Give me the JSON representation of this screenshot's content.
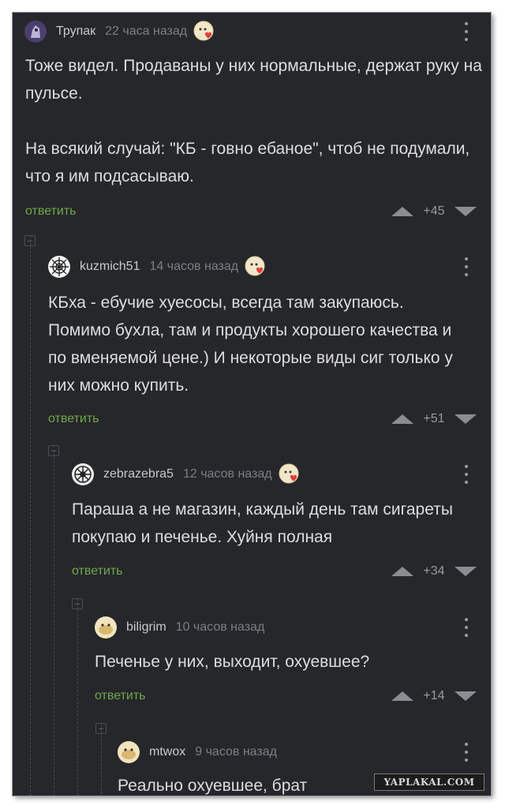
{
  "comments": [
    {
      "username": "Трупак",
      "time": "22 часа назад",
      "text": "Тоже видел. Продаваны у них нормальные, держат руку на пульсе.\n\nНа всякий случай: \"КБ - говно ебаное\", чтоб не подумали, что я им подсасываю.",
      "reply_label": "ответить",
      "score": "+45",
      "avatar_icon": "knight-avatar-icon",
      "has_badge": true
    },
    {
      "username": "kuzmich51",
      "time": "14 часов назад",
      "text": "КБха - ебучие хуесосы, всегда там закупаюсь. Помимо бухла, там и продукты хорошего качества и по вменяемой цене.) И некоторые виды сиг только у них можно купить.",
      "reply_label": "ответить",
      "score": "+51",
      "avatar_icon": "spiderweb-avatar-icon",
      "has_badge": true
    },
    {
      "username": "zebrazebra5",
      "time": "12 часов назад",
      "text": "Параша а не магазин, каждый день там сигареты покупаю и печенье. Хуйня полная",
      "reply_label": "ответить",
      "score": "+34",
      "avatar_icon": "wheel-avatar-icon",
      "has_badge": true
    },
    {
      "username": "biligrim",
      "time": "10 часов назад",
      "text": "Печенье у них, выходит, охуевшее?",
      "reply_label": "ответить",
      "score": "+14",
      "avatar_icon": "cookie-avatar-icon",
      "has_badge": false
    },
    {
      "username": "mtwox",
      "time": "9 часов назад",
      "text": "Реально охуевшее, брат",
      "avatar_icon": "cookie-avatar-icon",
      "has_badge": false
    }
  ],
  "watermark": "YAPLAKAL.COM",
  "colors": {
    "background": "#26272b",
    "text": "#dddde0",
    "reply_link": "#6fa84a",
    "muted": "#7d7e84"
  }
}
